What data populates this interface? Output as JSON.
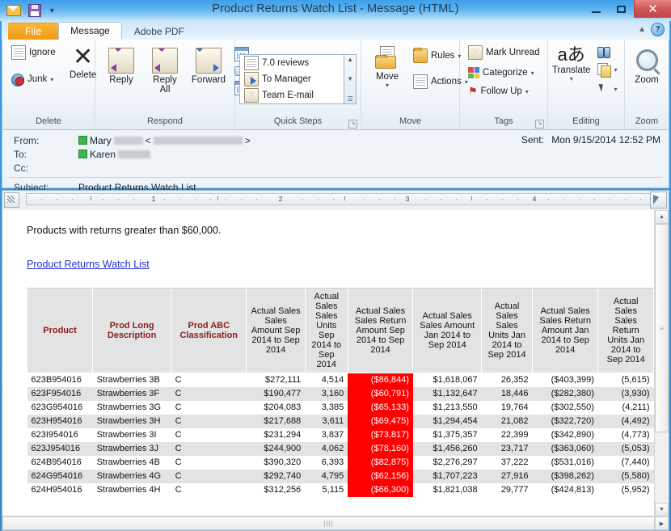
{
  "window": {
    "title": "Product Returns Watch List  -  Message (HTML)",
    "quick_access": [
      "mail-icon",
      "save-icon",
      "customize-dropdown-icon"
    ],
    "controls": {
      "minimize": "–",
      "maximize": "❐",
      "close": "✕"
    },
    "help_glyph": "?",
    "collapse_ribbon_glyph": "▲"
  },
  "tabs": [
    {
      "label": "File",
      "id": "file"
    },
    {
      "label": "Message",
      "id": "message"
    },
    {
      "label": "Adobe PDF",
      "id": "adobe-pdf"
    }
  ],
  "ribbon": {
    "groups": [
      {
        "name": "Delete",
        "label": "Delete",
        "items": [
          {
            "label": "Ignore",
            "icon": "ignore-icon"
          },
          {
            "label": "Junk",
            "icon": "junk-icon",
            "caret": "▾"
          },
          {
            "label": "Delete",
            "icon": "delete-x-icon"
          }
        ]
      },
      {
        "name": "Respond",
        "label": "Respond",
        "items": [
          {
            "label": "Reply",
            "icon": "reply-icon"
          },
          {
            "label": "Reply All",
            "icon": "reply-all-icon"
          },
          {
            "label": "Forward",
            "icon": "forward-icon"
          },
          {
            "label": "",
            "icon": "meeting-icon",
            "caret": ""
          },
          {
            "label": "",
            "icon": "im-icon",
            "caret": "▾"
          },
          {
            "label": "",
            "icon": "more-respond-icon",
            "caret": "▾"
          }
        ]
      },
      {
        "name": "Quick Steps",
        "label": "Quick Steps",
        "dialog_launcher": "↘",
        "items": [
          {
            "label": "7.0 reviews",
            "icon": "quickstep-reviews-icon"
          },
          {
            "label": "To Manager",
            "icon": "quickstep-to-manager-icon"
          },
          {
            "label": "Team E-mail",
            "icon": "quickstep-team-email-icon"
          }
        ],
        "scroll": {
          "up": "▲",
          "down": "▼",
          "more": "☰"
        }
      },
      {
        "name": "Move",
        "label": "Move",
        "items": [
          {
            "label": "Move",
            "icon": "move-folder-icon",
            "caret": "▾"
          },
          {
            "label": "Rules",
            "icon": "rules-icon",
            "caret": "▾"
          },
          {
            "label": "Actions",
            "icon": "actions-icon",
            "caret": "▾"
          }
        ]
      },
      {
        "name": "Tags",
        "label": "Tags",
        "dialog_launcher": "↘",
        "items": [
          {
            "label": "Mark Unread",
            "icon": "mark-unread-icon"
          },
          {
            "label": "Categorize",
            "icon": "categorize-icon",
            "caret": "▾"
          },
          {
            "label": "Follow Up",
            "icon": "follow-up-flag-icon",
            "caret": "▾"
          }
        ]
      },
      {
        "name": "Editing",
        "label": "Editing",
        "items": [
          {
            "label": "Translate",
            "icon": "translate-icon",
            "caret": "▾"
          },
          {
            "label": "",
            "icon": "find-binoculars-icon"
          },
          {
            "label": "",
            "icon": "related-copy-icon",
            "caret": "▾"
          },
          {
            "label": "",
            "icon": "select-pointer-icon",
            "caret": "▾"
          }
        ]
      },
      {
        "name": "Zoom",
        "label": "Zoom",
        "items": [
          {
            "label": "Zoom",
            "icon": "zoom-magnifier-icon"
          }
        ]
      }
    ]
  },
  "header": {
    "from_label": "From:",
    "from_name": "Mary",
    "from_redacted_name_width": 36,
    "from_email_open": "<",
    "from_email_redacted_width": 110,
    "from_email_close": ">",
    "to_label": "To:",
    "to_name": "Karen",
    "to_redacted_width": 40,
    "cc_label": "Cc:",
    "cc_value": "",
    "subject_label": "Subject:",
    "subject_value": "Product Returns Watch List",
    "sent_label": "Sent:",
    "sent_value": "Mon 9/15/2014 12:52 PM"
  },
  "ruler": {
    "numbers": [
      "1",
      "2",
      "3",
      "4"
    ],
    "tab_stop_button": "left-tab-stop-icon"
  },
  "body": {
    "intro_text": "Products with returns greater than $60,000.",
    "link_text": "Product Returns Watch List"
  },
  "table": {
    "headers": [
      "Product",
      "Prod Long Description",
      "Prod ABC Classification",
      "Actual Sales Sales Amount Sep 2014 to Sep 2014",
      "Actual Sales Sales Units Sep 2014 to Sep 2014",
      "Actual Sales Sales Return Amount Sep 2014 to Sep 2014",
      "Actual Sales Sales Amount Jan 2014 to Sep 2014",
      "Actual Sales Sales Units Jan 2014 to Sep 2014",
      "Actual Sales Sales Return Amount Jan 2014 to Sep 2014",
      "Actual Sales Sales Return Units Jan 2014 to Sep 2014"
    ],
    "header_accent_color": "#8a1c1c",
    "highlight_color": "#fe0000",
    "rows": [
      [
        "623B954016",
        "Strawberries 3B",
        "C",
        "$272,111",
        "4,514",
        "($86,844)",
        "$1,618,067",
        "26,352",
        "($403,399)",
        "(5,615)"
      ],
      [
        "623F954016",
        "Strawberries 3F",
        "C",
        "$190,477",
        "3,160",
        "($60,791)",
        "$1,132,647",
        "18,446",
        "($282,380)",
        "(3,930)"
      ],
      [
        "623G954016",
        "Strawberries 3G",
        "C",
        "$204,083",
        "3,385",
        "($65,133)",
        "$1,213,550",
        "19,764",
        "($302,550)",
        "(4,211)"
      ],
      [
        "623H954016",
        "Strawberries 3H",
        "C",
        "$217,688",
        "3,611",
        "($69,475)",
        "$1,294,454",
        "21,082",
        "($322,720)",
        "(4,492)"
      ],
      [
        "623I954016",
        "Strawberries 3I",
        "C",
        "$231,294",
        "3,837",
        "($73,817)",
        "$1,375,357",
        "22,399",
        "($342,890)",
        "(4,773)"
      ],
      [
        "623J954016",
        "Strawberries 3J",
        "C",
        "$244,900",
        "4,062",
        "($78,160)",
        "$1,456,260",
        "23,717",
        "($363,060)",
        "(5,053)"
      ],
      [
        "624B954016",
        "Strawberries 4B",
        "C",
        "$390,320",
        "6,393",
        "($82,875)",
        "$2,276,297",
        "37,222",
        "($531,016)",
        "(7,440)"
      ],
      [
        "624G954016",
        "Strawberries 4G",
        "C",
        "$292,740",
        "4,795",
        "($62,156)",
        "$1,707,223",
        "27,916",
        "($398,262)",
        "(5,580)"
      ],
      [
        "624H954016",
        "Strawberries 4H",
        "C",
        "$312,256",
        "5,115",
        "($66,300)",
        "$1,821,038",
        "29,777",
        "($424,813)",
        "(5,952)"
      ]
    ],
    "red_column_index": 5
  },
  "scrollbars": {
    "v_up": "▲",
    "v_down": "▼",
    "v_grip": "≡",
    "h_grip": "||||",
    "h_right": "▶"
  }
}
